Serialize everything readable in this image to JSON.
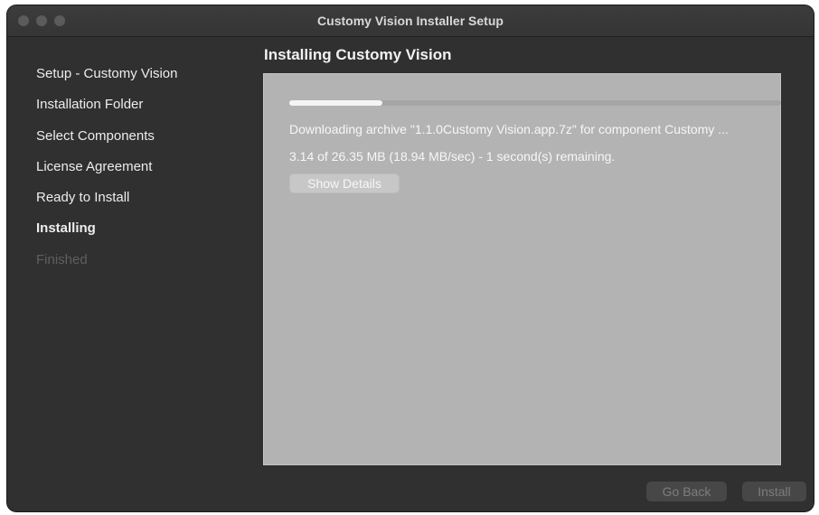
{
  "window": {
    "title": "Customy Vision Installer Setup"
  },
  "sidebar": {
    "items": [
      {
        "label": "Setup - Customy Vision",
        "state": "done"
      },
      {
        "label": "Installation Folder",
        "state": "done"
      },
      {
        "label": "Select Components",
        "state": "done"
      },
      {
        "label": "License Agreement",
        "state": "done"
      },
      {
        "label": "Ready to Install",
        "state": "done"
      },
      {
        "label": "Installing",
        "state": "active"
      },
      {
        "label": "Finished",
        "state": "disabled"
      }
    ]
  },
  "main": {
    "heading": "Installing Customy Vision",
    "progress_fraction": 0.19,
    "status_line_1": "Downloading archive \"1.1.0Customy Vision.app.7z\" for component Customy ...",
    "status_line_2": "3.14 of 26.35 MB (18.94 MB/sec) - 1 second(s) remaining.",
    "show_details_label": "Show Details"
  },
  "footer": {
    "back_label": "Go Back",
    "install_label": "Install"
  }
}
